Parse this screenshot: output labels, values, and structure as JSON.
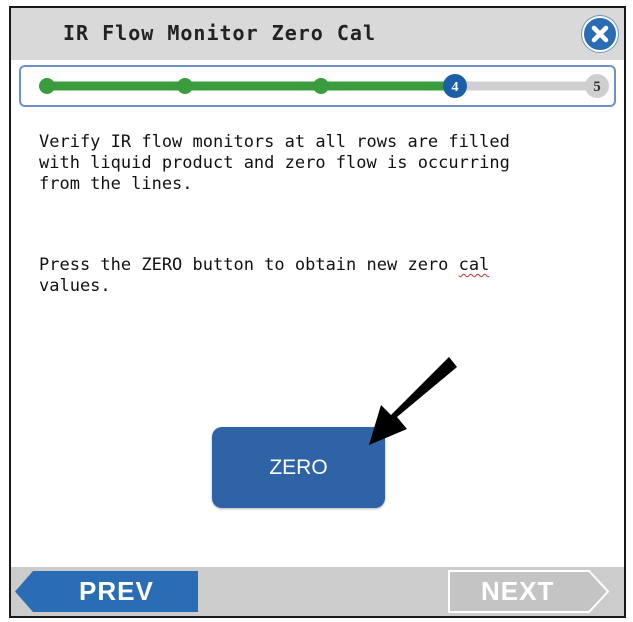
{
  "header": {
    "title": "IR Flow Monitor Zero Cal",
    "close_icon": "close-icon"
  },
  "progress": {
    "current_step": 4,
    "total_steps": 5,
    "current_label": "4",
    "last_label": "5",
    "completed_color": "#3a9c3c",
    "current_color": "#1c5ea8",
    "pending_color": "#cfcfcf"
  },
  "instructions": {
    "paragraph1": "Verify IR flow monitors at all rows are filled\nwith liquid product and zero flow is occurring\nfrom the lines.",
    "paragraph2_before": "Press the ZERO button to obtain new zero ",
    "paragraph2_underlined": "cal",
    "paragraph2_after": "\nvalues."
  },
  "zero_button": {
    "label": "ZERO"
  },
  "footer": {
    "prev_label": "PREV",
    "next_label": "NEXT"
  },
  "colors": {
    "accent": "#2e63a6",
    "nav_prev": "#2a6db5",
    "nav_next_disabled": "#c4c4c4"
  }
}
